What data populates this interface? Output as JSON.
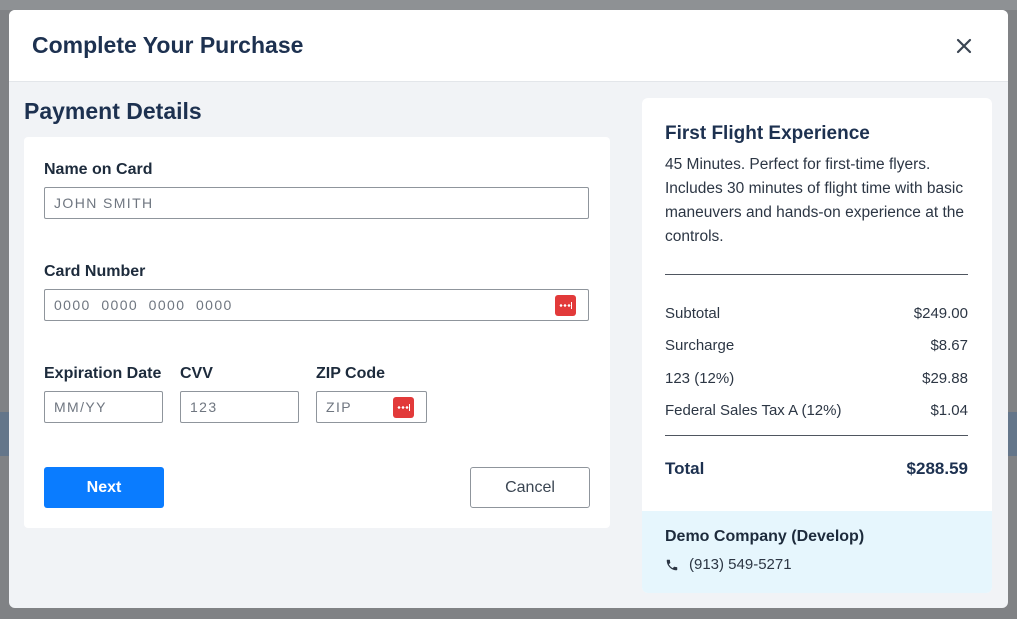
{
  "modal": {
    "title": "Complete Your Purchase"
  },
  "payment": {
    "section_title": "Payment Details",
    "name_label": "Name on Card",
    "name_placeholder": "JOHN SMITH",
    "card_label": "Card Number",
    "card_placeholder": "0000  0000  0000  0000",
    "exp_label": "Expiration Date",
    "exp_placeholder": "MM/YY",
    "cvv_label": "CVV",
    "cvv_placeholder": "123",
    "zip_label": "ZIP Code",
    "zip_placeholder": "ZIP",
    "next_label": "Next",
    "cancel_label": "Cancel"
  },
  "summary": {
    "product_title": "First Flight Experience",
    "product_desc": "45 Minutes. Perfect for first-time flyers. Includes 30 minutes of flight time with basic maneuvers and hands-on experience at the controls.",
    "lines": [
      {
        "label": "Subtotal",
        "amount": "$249.00"
      },
      {
        "label": "Surcharge",
        "amount": "$8.67"
      },
      {
        "label": "123 (12%)",
        "amount": "$29.88"
      },
      {
        "label": "Federal Sales Tax A (12%)",
        "amount": "$1.04"
      }
    ],
    "total_label": "Total",
    "total_amount": "$288.59",
    "company_name": "Demo Company (Develop)",
    "company_phone": "(913) 549-5271"
  },
  "colors": {
    "primary_button": "#0a7cff",
    "heading": "#1d3150",
    "card_icon": "#e23a3a",
    "company_bg": "#e6f6fd"
  },
  "icons": {
    "close": "close-icon",
    "card": "credit-card-icon",
    "phone": "phone-icon"
  }
}
